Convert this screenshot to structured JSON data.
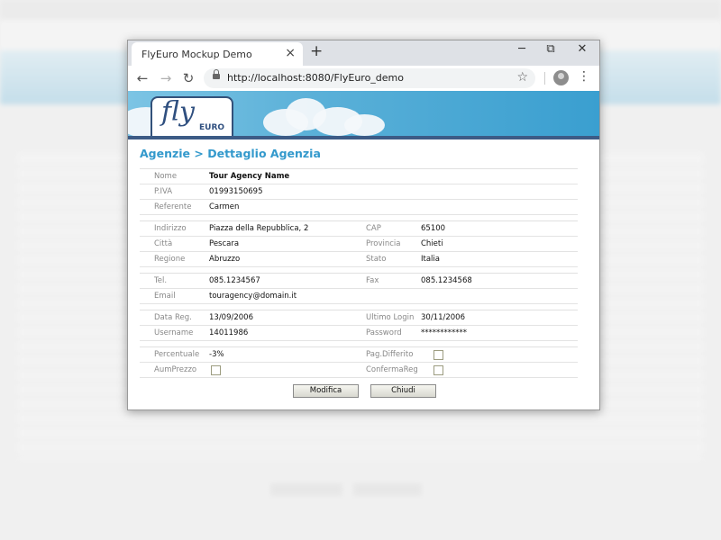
{
  "browser": {
    "tab_title": "FlyEuro Mockup Demo",
    "tab_close": "×",
    "new_tab": "+",
    "url": "http://localhost:8080/FlyEuro_demo",
    "controls": {
      "minimize": "─",
      "maximize": "⧉",
      "close": "✕"
    },
    "nav": {
      "back": "←",
      "forward": "→",
      "reload": "↻"
    },
    "star": "☆",
    "menu": "⋮"
  },
  "logo": {
    "fly": "fly",
    "euro": "EURO"
  },
  "page_title": "Agenzie > Dettaglio Agenzia",
  "sections": [
    {
      "rows": [
        {
          "l1": "Nome",
          "v1": "Tour Agency Name"
        },
        {
          "l1": "P.IVA",
          "v1": "01993150695"
        },
        {
          "l1": "Referente",
          "v1": "Carmen"
        }
      ]
    },
    {
      "rows": [
        {
          "l1": "Indirizzo",
          "v1": "Piazza della Repubblica, 2",
          "l2": "CAP",
          "v2": "65100"
        },
        {
          "l1": "Città",
          "v1": "Pescara",
          "l2": "Provincia",
          "v2": "Chieti"
        },
        {
          "l1": "Regione",
          "v1": "Abruzzo",
          "l2": "Stato",
          "v2": "Italia"
        }
      ]
    },
    {
      "rows": [
        {
          "l1": "Tel.",
          "v1": "085.1234567",
          "l2": "Fax",
          "v2": "085.1234568"
        },
        {
          "l1": "Email",
          "v1": "touragency@domain.it"
        }
      ]
    },
    {
      "rows": [
        {
          "l1": "Data Reg.",
          "v1": "13/09/2006",
          "l2": "Ultimo Login",
          "v2": "30/11/2006"
        },
        {
          "l1": "Username",
          "v1": "14011986",
          "l2": "Password",
          "v2": "************"
        }
      ]
    },
    {
      "rows": [
        {
          "l1": "Percentuale",
          "v1": "-3%",
          "l2": "Pag.Differito",
          "checked2": false
        },
        {
          "l1": "AumPrezzo",
          "checked1": false,
          "l2": "ConfermaReg",
          "checked2": false
        }
      ]
    }
  ],
  "buttons": {
    "modifica": "Modifica",
    "chiudi": "Chiudi"
  },
  "colors": {
    "heading": "#3399cc",
    "logo": "#2f4f7f",
    "banner": "#5ab0d8"
  }
}
